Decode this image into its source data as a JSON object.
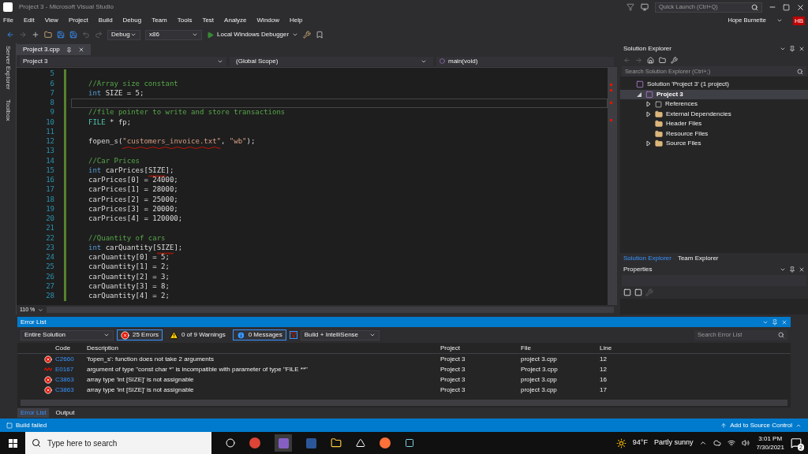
{
  "window": {
    "title": "Project 3 - Microsoft Visual Studio",
    "quick_launch": {
      "placeholder": "Quick Launch (Ctrl+Q)"
    },
    "user": "Hope Burnette",
    "initials": "HB"
  },
  "menu": [
    "File",
    "Edit",
    "View",
    "Project",
    "Build",
    "Debug",
    "Team",
    "Tools",
    "Test",
    "Analyze",
    "Window",
    "Help"
  ],
  "toolbar": {
    "configuration": "Debug",
    "platform": "x86",
    "run": "Local Windows Debugger"
  },
  "side_tabs": [
    "Server Explorer",
    "Toolbox"
  ],
  "document_tabs": [
    {
      "label": "Project 3.cpp",
      "selected": true
    }
  ],
  "navigation": {
    "project": "Project 3",
    "scope": "(Global Scope)",
    "member": "main(void)"
  },
  "code_lines": [
    {
      "number": "5",
      "current": false
    },
    {
      "number": "6",
      "current": false,
      "tokens": [
        {
          "kind": "comment",
          "text": "//Array size constant",
          "squiggle": false
        }
      ]
    },
    {
      "number": "7",
      "current": false,
      "tokens": [
        {
          "kind": "keyword",
          "text": "int",
          "squiggle": false
        },
        {
          "kind": "plain",
          "text": " SIZE = 5;",
          "squiggle": false
        }
      ]
    },
    {
      "number": "8",
      "current": true
    },
    {
      "number": "9",
      "current": false,
      "tokens": [
        {
          "kind": "comment",
          "text": "//file pointer to write and store transactions",
          "squiggle": false
        }
      ]
    },
    {
      "number": "10",
      "current": false,
      "tokens": [
        {
          "kind": "type",
          "text": "FILE",
          "squiggle": false
        },
        {
          "kind": "plain",
          "text": " * fp;",
          "squiggle": false
        }
      ]
    },
    {
      "number": "11",
      "current": false
    },
    {
      "number": "12",
      "current": false,
      "tokens": [
        {
          "kind": "plain",
          "text": "fopen_s(",
          "squiggle": false
        },
        {
          "kind": "string",
          "text": "\"customers_invoice.txt\"",
          "squiggle": true
        },
        {
          "kind": "plain",
          "text": ", ",
          "squiggle": false
        },
        {
          "kind": "string",
          "text": "\"wb\"",
          "squiggle": false
        },
        {
          "kind": "plain",
          "text": ");",
          "squiggle": false
        }
      ]
    },
    {
      "number": "13",
      "current": false
    },
    {
      "number": "14",
      "current": false,
      "tokens": [
        {
          "kind": "comment",
          "text": "//Car Prices",
          "squiggle": false
        }
      ]
    },
    {
      "number": "15",
      "current": false,
      "tokens": [
        {
          "kind": "keyword",
          "text": "int",
          "squiggle": false
        },
        {
          "kind": "plain",
          "text": " carPrices[",
          "squiggle": false
        },
        {
          "kind": "plain",
          "text": "SIZE",
          "squiggle": true
        },
        {
          "kind": "plain",
          "text": "];",
          "squiggle": false
        }
      ]
    },
    {
      "number": "16",
      "current": false,
      "tokens": [
        {
          "kind": "plain",
          "text": "carPrices[0] = 24000;",
          "squiggle": false
        }
      ]
    },
    {
      "number": "17",
      "current": false,
      "tokens": [
        {
          "kind": "plain",
          "text": "carPrices[1] = 28000;",
          "squiggle": false
        }
      ]
    },
    {
      "number": "18",
      "current": false,
      "tokens": [
        {
          "kind": "plain",
          "text": "carPrices[2] = 25000;",
          "squiggle": false
        }
      ]
    },
    {
      "number": "19",
      "current": false,
      "tokens": [
        {
          "kind": "plain",
          "text": "carPrices[3] = 20000;",
          "squiggle": false
        }
      ]
    },
    {
      "number": "20",
      "current": false,
      "tokens": [
        {
          "kind": "plain",
          "text": "carPrices[4] = 120000;",
          "squiggle": false
        }
      ]
    },
    {
      "number": "21",
      "current": false
    },
    {
      "number": "22",
      "current": false,
      "tokens": [
        {
          "kind": "comment",
          "text": "//Quantity of cars",
          "squiggle": false
        }
      ]
    },
    {
      "number": "23",
      "current": false,
      "tokens": [
        {
          "kind": "keyword",
          "text": "int",
          "squiggle": false
        },
        {
          "kind": "plain",
          "text": " carQuantity[",
          "squiggle": false
        },
        {
          "kind": "plain",
          "text": "SIZE",
          "squiggle": true
        },
        {
          "kind": "plain",
          "text": "];",
          "squiggle": false
        }
      ]
    },
    {
      "number": "24",
      "current": false,
      "tokens": [
        {
          "kind": "plain",
          "text": "carQuantity[0] = 5;",
          "squiggle": false
        }
      ]
    },
    {
      "number": "25",
      "current": false,
      "tokens": [
        {
          "kind": "plain",
          "text": "carQuantity[1] = 2;",
          "squiggle": false
        }
      ]
    },
    {
      "number": "26",
      "current": false,
      "tokens": [
        {
          "kind": "plain",
          "text": "carQuantity[2] = 3;",
          "squiggle": false
        }
      ]
    },
    {
      "number": "27",
      "current": false,
      "tokens": [
        {
          "kind": "plain",
          "text": "carQuantity[3] = 8;",
          "squiggle": false
        }
      ]
    },
    {
      "number": "28",
      "current": false,
      "tokens": [
        {
          "kind": "plain",
          "text": "carQuantity[4] = 2;",
          "squiggle": false
        }
      ]
    }
  ],
  "zoom": "110 %",
  "solution_explorer": {
    "title": "Solution Explorer",
    "search": {
      "placeholder": "Search Solution Explorer (Ctrl+;)"
    },
    "tree": [
      {
        "label": "Solution 'Project 3' (1 project)",
        "kind": "solution",
        "selected": false,
        "children": [
          {
            "label": "Project 3",
            "kind": "project",
            "expanded": true,
            "selected": true,
            "children": [
              {
                "label": "References",
                "kind": "references",
                "expanded": false,
                "selected": false
              },
              {
                "label": "External Dependencies",
                "kind": "dependencies",
                "expanded": false,
                "selected": false
              },
              {
                "label": "Header Files",
                "kind": "folder",
                "selected": false
              },
              {
                "label": "Resource Files",
                "kind": "folder",
                "selected": false
              },
              {
                "label": "Source Files",
                "kind": "folder",
                "expanded": false,
                "selected": false
              }
            ]
          }
        ]
      }
    ],
    "tabs": [
      {
        "label": "Solution Explorer",
        "selected": true
      },
      {
        "label": "Team Explorer",
        "selected": false
      }
    ]
  },
  "properties": {
    "title": "Properties"
  },
  "error_list": {
    "title": "Error List",
    "scope": "Entire Solution",
    "filters": [
      {
        "kind": "error",
        "label": "25 Errors",
        "selected": true
      },
      {
        "kind": "warning",
        "label": "0 of 9 Warnings",
        "selected": false
      },
      {
        "kind": "message",
        "label": "0 Messages",
        "selected": true
      }
    ],
    "source": "Build + IntelliSense",
    "search": {
      "placeholder": "Search Error List"
    },
    "columns": [
      "Code",
      "Description",
      "Project",
      "File",
      "Line"
    ],
    "rows": [
      {
        "kind": "error",
        "code": "C2660",
        "description": "'fopen_s': function does not take 2 arguments",
        "project": "Project 3",
        "file": "project 3.cpp",
        "line": "12"
      },
      {
        "kind": "intellisense",
        "code": "E0167",
        "description": "argument of type \"const char *\" is incompatible with parameter of type \"FILE **\"",
        "project": "Project 3",
        "file": "Project 3.cpp",
        "line": "12"
      },
      {
        "kind": "error",
        "code": "C3863",
        "description": "array type 'int [SIZE]' is not assignable",
        "project": "Project 3",
        "file": "project 3.cpp",
        "line": "16"
      },
      {
        "kind": "error",
        "code": "C3863",
        "description": "array type 'int [SIZE]' is not assignable",
        "project": "Project 3",
        "file": "project 3.cpp",
        "line": "17"
      }
    ],
    "tabs": [
      {
        "label": "Error List",
        "selected": true
      },
      {
        "label": "Output",
        "selected": false
      }
    ]
  },
  "status_bar": {
    "message": "Build failed",
    "source_control": "Add to Source Control"
  },
  "taskbar": {
    "search": {
      "placeholder": "Type here to search"
    },
    "temperature": "94°F",
    "weather": "Partly sunny",
    "time": "3:01 PM",
    "date": "7/30/2021",
    "notifications": "2"
  }
}
